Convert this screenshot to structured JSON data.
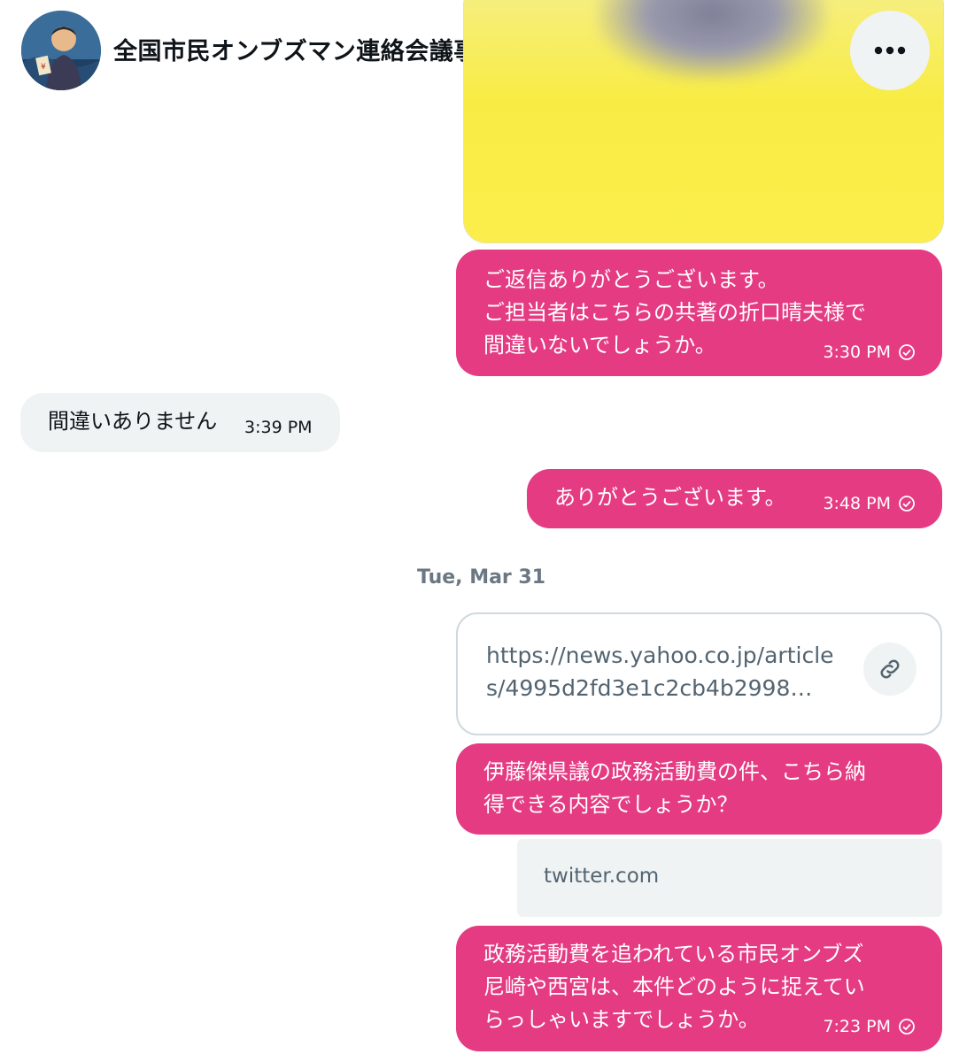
{
  "header": {
    "title": "全国市民オンブズマン連絡会議事務局",
    "avatar_icon": "person-avatar-icon",
    "more_icon": "ellipsis-icon"
  },
  "media": {
    "description_icon": "image-thumbnail"
  },
  "messages": [
    {
      "side": "sent",
      "text": "ご返信ありがとうございます。\nご担当者はこちらの共著の折口晴夫様で\n間違いないでしょうか。",
      "time": "3:30 PM"
    },
    {
      "side": "received",
      "text": "間違いありません",
      "time": "3:39 PM"
    },
    {
      "side": "sent",
      "text": "ありがとうございます。",
      "time": "3:48 PM"
    },
    {
      "side": "sent",
      "text": "伊藤傑県議の政務活動費の件、こちら納\n得できる内容でしょうか？"
    },
    {
      "side": "sent",
      "text": "政務活動費を追われている市民オンブズ\n尼崎や西宮は、本件どのように捉えてい\nらっしゃいますでしょうか。",
      "time": "7:23 PM"
    }
  ],
  "date_separator": "Tue, Mar 31",
  "link_card": {
    "url": "https://news.yahoo.co.jp/articles/4995d2fd3e1c2cb4b2998…",
    "icon": "link-icon"
  },
  "domain_card": {
    "domain": "twitter.com"
  },
  "colors": {
    "sent_bubble": "#e43b82",
    "received_bubble": "#eff3f4",
    "muted_text": "#536471"
  }
}
